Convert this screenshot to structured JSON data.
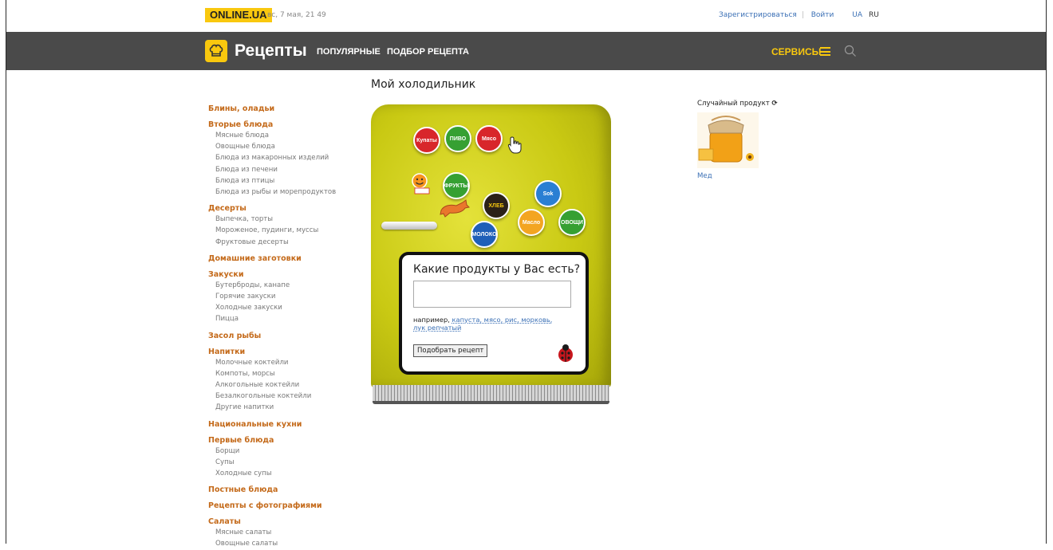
{
  "header": {
    "logo": "ONLINE.UA",
    "date": "вс, 7 мая, 21 49",
    "register_label": "Зарегистрироваться",
    "login_label": "Войти",
    "lang_ua": "UA",
    "lang_ru": "RU"
  },
  "nav": {
    "title": "Рецепты",
    "popular": "ПОПУЛЯРНЫЕ",
    "select_recipe": "ПОДБОР РЕЦЕПТА",
    "services": "СЕРВИСЫ"
  },
  "sidebar": [
    {
      "label": "Блины, оладьи",
      "subs": []
    },
    {
      "label": "Вторые блюда",
      "subs": [
        "Мясные блюда",
        "Овощные блюда",
        "Блюда из макаронных изделий",
        "Блюда из печени",
        "Блюда из птицы",
        "Блюда из рыбы и морепродуктов"
      ]
    },
    {
      "label": "Десерты",
      "subs": [
        "Выпечка, торты",
        "Мороженое, пудинги, муссы",
        "Фруктовые десерты"
      ]
    },
    {
      "label": "Домашние заготовки",
      "subs": []
    },
    {
      "label": "Закуски",
      "subs": [
        "Бутерброды, канапе",
        "Горячие закуски",
        "Холодные закуски",
        "Пицца"
      ]
    },
    {
      "label": "Засол рыбы",
      "subs": []
    },
    {
      "label": "Напитки",
      "subs": [
        "Молочные коктейли",
        "Компоты, морсы",
        "Алкогольные коктейли",
        "Безалкогольные коктейли",
        "Другие напитки"
      ]
    },
    {
      "label": "Национальные кухни",
      "subs": []
    },
    {
      "label": "Первые блюда",
      "subs": [
        "Борщи",
        "Супы",
        "Холодные супы"
      ]
    },
    {
      "label": "Постные блюда",
      "subs": []
    },
    {
      "label": "Рецепты с фотографиями",
      "subs": []
    },
    {
      "label": "Салаты",
      "subs": [
        "Мясные салаты",
        "Овощные салаты"
      ]
    }
  ],
  "main": {
    "title": "Мой холодильник",
    "magnets": {
      "kupaty": "Купаты",
      "pivo": "ПИВО",
      "myaso": "Мясо",
      "frukty": "ФРУКТЫ",
      "sok": "Sok",
      "hleb": "ХЛЕБ",
      "maslo": "Масло",
      "ovoshchi": "ОВОЩИ",
      "moloko": "МОЛОКО"
    },
    "question": "Какие продукты у Вас есть?",
    "input_value": "",
    "hint_prefix": "например, ",
    "hint_examples": "капуста, мясо, рис, морковь, лук репчатый",
    "button_label": "Подобрать рецепт"
  },
  "random_product": {
    "label": "Случайный продукт",
    "name": "Мед"
  },
  "colors": {
    "accent_yellow": "#f9c80e",
    "nav_bg": "#4a4a4a",
    "category_orange": "#c46a1a",
    "link_blue": "#3a6fb5",
    "fridge_yellow": "#c9c913"
  }
}
